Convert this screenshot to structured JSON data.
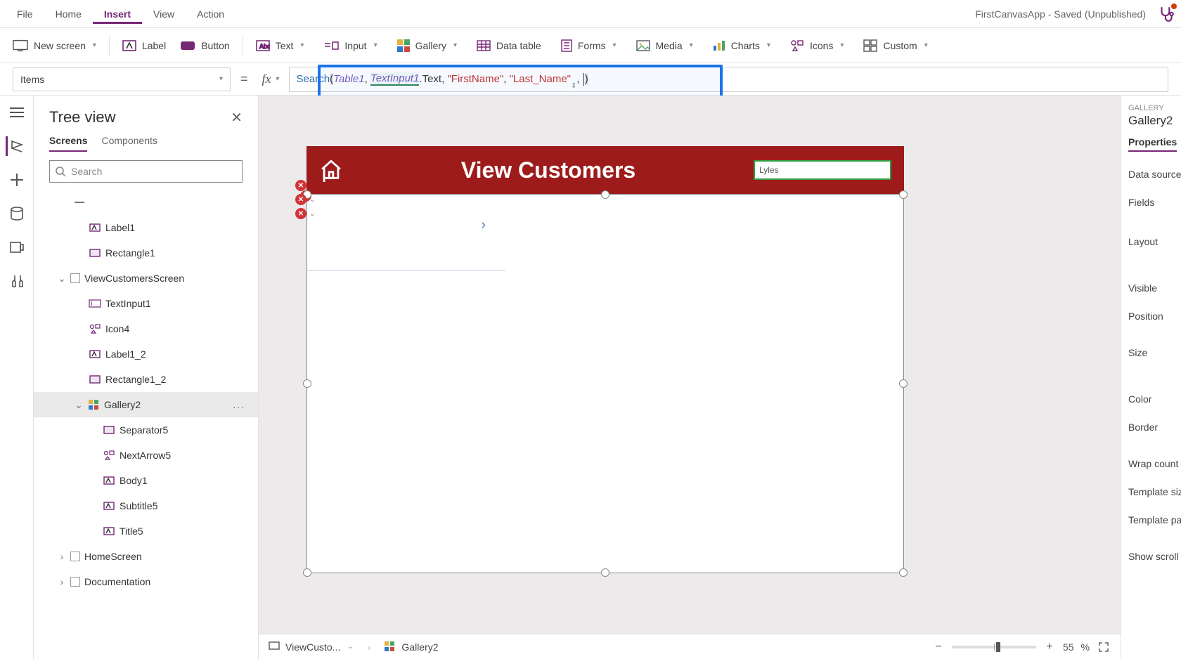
{
  "menu": {
    "file": "File",
    "home": "Home",
    "insert": "Insert",
    "view": "View",
    "action": "Action"
  },
  "app_title": "FirstCanvasApp - Saved (Unpublished)",
  "ribbon": {
    "new_screen": "New screen",
    "label": "Label",
    "button": "Button",
    "text": "Text",
    "input": "Input",
    "gallery": "Gallery",
    "data_table": "Data table",
    "forms": "Forms",
    "media": "Media",
    "charts": "Charts",
    "icons": "Icons",
    "custom": "Custom"
  },
  "formula": {
    "property": "Items",
    "fn": "Search",
    "table": "Table1",
    "var": "TextInput1",
    "vartail": ".Text",
    "a1": "\"FirstName\"",
    "a2": "\"Last_Name\""
  },
  "tree": {
    "title": "Tree view",
    "tab_screens": "Screens",
    "tab_components": "Components",
    "search_ph": "Search",
    "label1": "Label1",
    "rect1": "Rectangle1",
    "screen2": "ViewCustomersScreen",
    "textinput": "TextInput1",
    "icon4": "Icon4",
    "label12": "Label1_2",
    "rect12": "Rectangle1_2",
    "gallery": "Gallery2",
    "sep": "Separator5",
    "next": "NextArrow5",
    "body": "Body1",
    "subtitle": "Subtitle5",
    "title5": "Title5",
    "home": "HomeScreen",
    "doc": "Documentation",
    "more": "..."
  },
  "canvas": {
    "header_title": "View Customers",
    "search_value": "Lyles"
  },
  "footer": {
    "bc1": "ViewCusto...",
    "bc2": "Gallery2",
    "zoom_value": "55",
    "zoom_unit": "%",
    "scroll_label": "Show scroll"
  },
  "props": {
    "cap": "GALLERY",
    "name": "Gallery2",
    "tab": "Properties",
    "data_source": "Data source",
    "fields": "Fields",
    "layout": "Layout",
    "visible": "Visible",
    "position": "Position",
    "size": "Size",
    "color": "Color",
    "border": "Border",
    "wrap": "Wrap count",
    "tsize": "Template siz",
    "tpad": "Template pa"
  },
  "chev_ic": "▾"
}
